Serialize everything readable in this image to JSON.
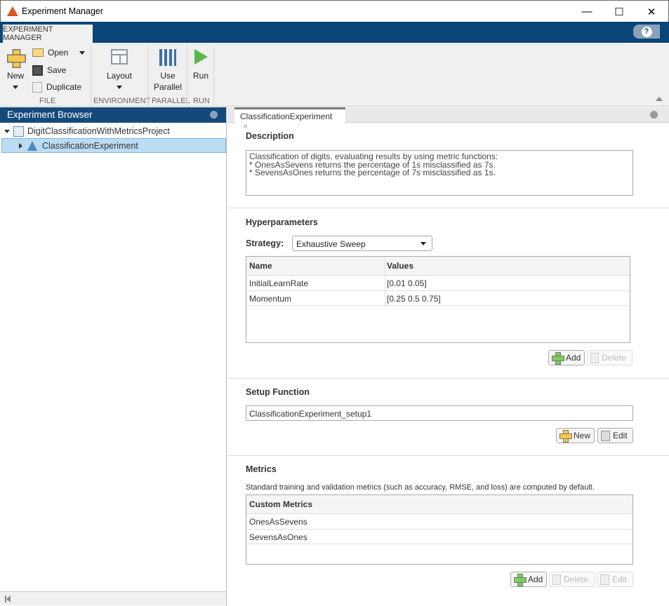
{
  "window": {
    "title": "Experiment Manager",
    "minimize": "—",
    "maximize": "☐",
    "close": "✕"
  },
  "ribbon": {
    "tab": "EXPERIMENT MANAGER",
    "help": "?",
    "new": "New",
    "open": "Open",
    "save": "Save",
    "duplicate": "Duplicate",
    "layout": "Layout",
    "use": "Use",
    "parallel": "Parallel",
    "run": "Run",
    "groups": {
      "file": "FILE",
      "environment": "ENVIRONMENT",
      "parallel": "PARALLEL",
      "run": "RUN"
    }
  },
  "browser": {
    "title": "Experiment Browser",
    "project": "DigitClassificationWithMetricsProject",
    "experiment": "ClassificationExperiment"
  },
  "editor": {
    "tab": "ClassificationExperiment",
    "description": {
      "heading": "Description",
      "lines": [
        "Classification of digits, evaluating results by using metric functions:",
        "* OnesAsSevens returns the percentage of 1s misclassified as 7s.",
        "* SevensAsOnes returns the percentage of 7s misclassified as 1s."
      ]
    },
    "hyper": {
      "heading": "Hyperparameters",
      "strategy_label": "Strategy:",
      "strategy": "Exhaustive Sweep",
      "columns": [
        "Name",
        "Values"
      ],
      "rows": [
        [
          "InitialLearnRate",
          "[0.01 0.05]"
        ],
        [
          "Momentum",
          "[0.25 0.5 0.75]"
        ]
      ],
      "add": "Add",
      "delete": "Delete"
    },
    "setup": {
      "heading": "Setup Function",
      "value": "ClassificationExperiment_setup1",
      "new": "New",
      "edit": "Edit"
    },
    "metrics": {
      "heading": "Metrics",
      "note": "Standard training and validation metrics (such as accuracy, RMSE, and loss) are computed by default.",
      "column": "Custom Metrics",
      "rows": [
        "OnesAsSevens",
        "SevensAsOnes"
      ],
      "add": "Add",
      "delete": "Delete",
      "edit": "Edit"
    }
  }
}
